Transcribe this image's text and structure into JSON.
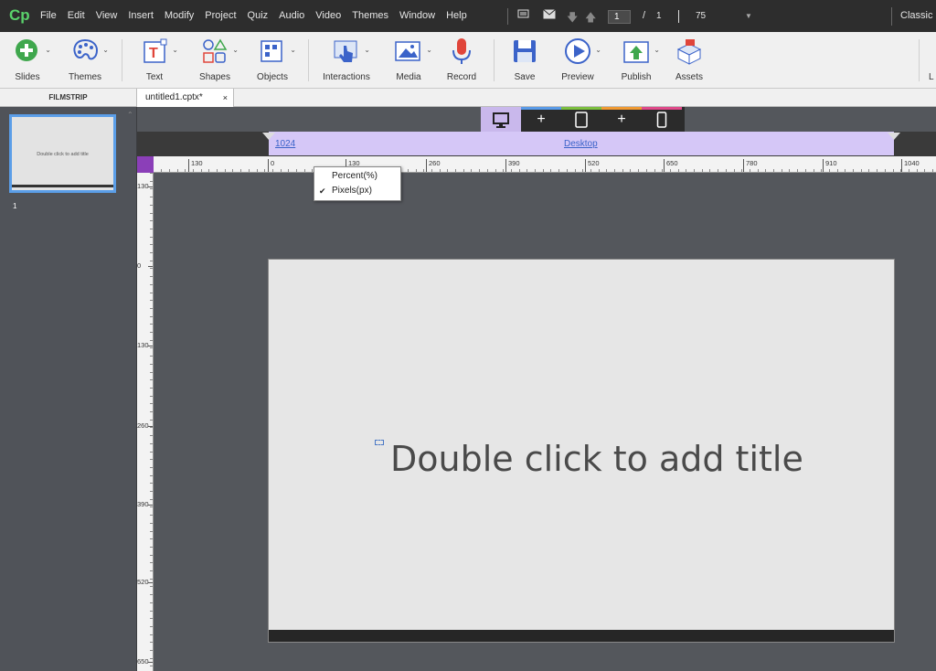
{
  "app": {
    "logo": "Cp"
  },
  "menu": [
    "File",
    "Edit",
    "View",
    "Insert",
    "Modify",
    "Project",
    "Quiz",
    "Audio",
    "Video",
    "Themes",
    "Window",
    "Help"
  ],
  "pager": {
    "current": "1",
    "separator": "/",
    "total": "1",
    "zoom": "75"
  },
  "workspace": "Classic",
  "toolbar": {
    "slides": "Slides",
    "themes": "Themes",
    "text": "Text",
    "shapes": "Shapes",
    "objects": "Objects",
    "interactions": "Interactions",
    "media": "Media",
    "record": "Record",
    "save": "Save",
    "preview": "Preview",
    "publish": "Publish",
    "assets": "Assets",
    "truncated": "L"
  },
  "filmstrip": {
    "header": "FILMSTRIP",
    "slide_title": "Double click to add title",
    "slide_number": "1"
  },
  "document_tab": {
    "name": "untitled1.cptx*",
    "close": "×"
  },
  "breakpoint": {
    "width": "1024",
    "name": "Desktop"
  },
  "ruler": {
    "h_labels": [
      "130",
      "0",
      "130",
      "260",
      "390",
      "520",
      "650",
      "780",
      "910",
      "1040"
    ],
    "v_labels": [
      "130",
      "0",
      "130",
      "260",
      "390",
      "520",
      "650"
    ]
  },
  "unit_menu": {
    "options": [
      "Percent(%)",
      "Pixels(px)"
    ],
    "checked": "✔"
  },
  "slide": {
    "title_placeholder": "Double click to add title"
  },
  "colors": {
    "accent_purple": "#d5c7f7",
    "ruler_corner": "#8b3fb8",
    "selection_blue": "#5b9ee8"
  }
}
